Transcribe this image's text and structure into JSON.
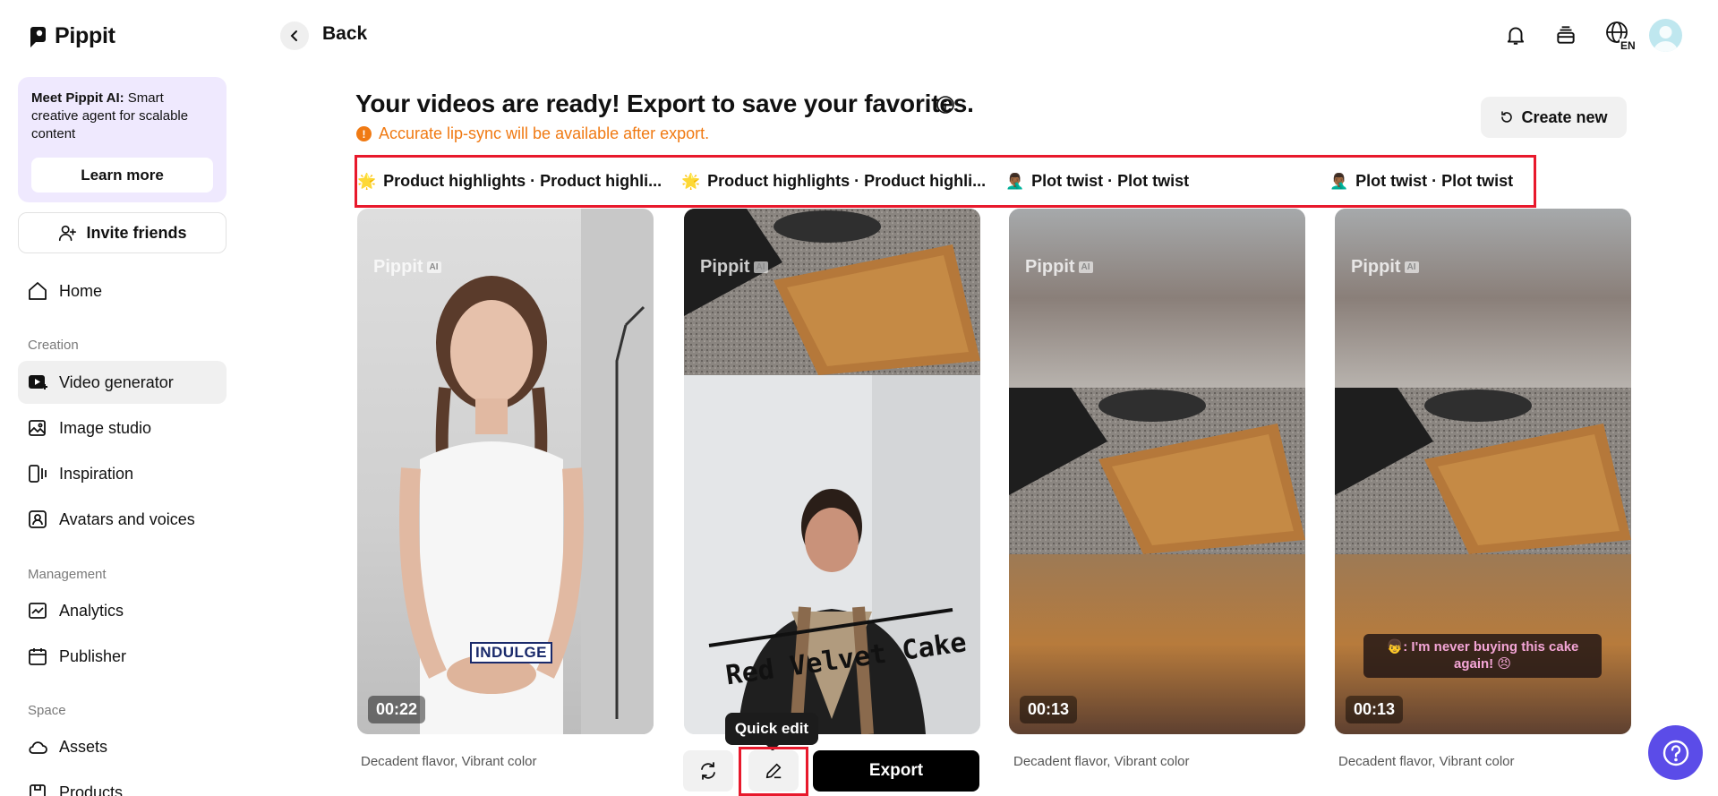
{
  "brand": {
    "name": "Pippit"
  },
  "sidebar": {
    "promo": {
      "title": "Meet Pippit AI:",
      "text": " Smart creative agent for scalable content",
      "button": "Learn more"
    },
    "invite": "Invite friends",
    "home": "Home",
    "sections": {
      "creation": "Creation",
      "management": "Management",
      "space": "Space"
    },
    "creation_items": [
      "Video generator",
      "Image studio",
      "Inspiration",
      "Avatars and voices"
    ],
    "management_items": [
      "Analytics",
      "Publisher"
    ],
    "space_items": [
      "Assets",
      "Products"
    ],
    "active_item": "Video generator"
  },
  "header": {
    "back": "Back",
    "lang_badge": "EN",
    "icons": [
      "bell-icon",
      "inbox-icon",
      "globe-icon",
      "avatar"
    ]
  },
  "main": {
    "title": "Your videos are ready! Export to save your favorites.",
    "warning": "Accurate lip-sync will be available after export.",
    "create_new": "Create new",
    "tabs": [
      {
        "emoji": "🌟",
        "label": "Product highlights · Product highli..."
      },
      {
        "emoji": "🌟",
        "label": "Product highlights · Product highli..."
      },
      {
        "emoji": "🤦🏾‍♂️",
        "label": "Plot twist · Plot twist"
      },
      {
        "emoji": "🤦🏾‍♂️",
        "label": "Plot twist · Plot twist"
      }
    ],
    "cards": [
      {
        "watermark": "Pippit",
        "watermark_badge": "AI",
        "duration": "00:22",
        "caption": "Decadent flavor, Vibrant color",
        "overlay_text": "INDULGE"
      },
      {
        "watermark": "Pippit",
        "watermark_badge": "AI",
        "overlay_text": "Red Velvet Cake"
      },
      {
        "watermark": "Pippit",
        "watermark_badge": "AI",
        "duration": "00:13",
        "caption": "Decadent flavor, Vibrant color"
      },
      {
        "watermark": "Pippit",
        "watermark_badge": "AI",
        "duration": "00:13",
        "caption": "Decadent flavor, Vibrant color",
        "overlay_text": "👦: I'm never buying this cake again! 😠"
      }
    ],
    "tooltip": "Quick edit",
    "export": "Export"
  },
  "colors": {
    "accent": "#5b4ce8",
    "warning": "#f07a13",
    "highlight_frame": "#e8192c",
    "promo_bg": "#efe9fe"
  }
}
